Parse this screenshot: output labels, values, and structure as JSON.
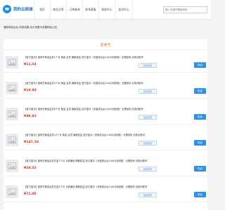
{
  "brand": {
    "name": "我的云商城",
    "logo_icon": "cart-icon"
  },
  "nav": [
    "首页",
    "商品分类",
    "订单查询",
    "联系客服",
    "帮助中心",
    "会员中心"
  ],
  "search": {
    "placeholder": "输入关键词搜索商品"
  },
  "notice": "通知网站后台-系统设置-站点设置中设置网站公告",
  "section": {
    "title": "爱奇艺"
  },
  "products": [
    {
      "title": "【官方直冲】爱奇艺黄金会员1个月 黄金 会员 爆款权益 官方直冲（充值成功后3-60分钟到账）无需密码 请核对账号",
      "price": "¥11.54",
      "badge": "自动发货",
      "button": "购买"
    },
    {
      "title": "【官方直冲】爱奇艺黄金会员3个月 黄金 会员 爆款权益 官方直冲（充值成功后3-60分钟到账）无需密码 请核对账号",
      "price": "¥19.98",
      "badge": "自动发货",
      "button": "购买"
    },
    {
      "title": "【官方直冲】爱奇艺黄金会员6个月 黄金 会员 爆款权益 官方直冲（充值成功后3-60分钟到账）无需密码 请核对账号",
      "price": "¥49.83",
      "badge": "自动发货",
      "button": "购买"
    },
    {
      "title": "【官方直冲】爱奇艺黄金会员12个月 黄金 会员 爆款权益 官方直冲（充值成功后3-60分钟到账）无需密码 请核对账号",
      "price": "¥147.18",
      "badge": "自动发货",
      "button": "购买"
    },
    {
      "title": "【官方直冲】爱奇艺黄金会员白金1个月 大屏通用 爆款权益 官方直冲（充值成功后3-60分钟到账）无需密码 请核对账号",
      "price": "¥28.53",
      "badge": "自动发货",
      "button": "购买"
    },
    {
      "title": "【官方直冲】爱奇艺黄金会员白金3个月 大屏通用 爆款权益 官方直冲（充值成功后3-60分钟到账）无需密码 请核对账号",
      "price": "¥71.88",
      "badge": "自动发货",
      "button": "购买"
    }
  ]
}
